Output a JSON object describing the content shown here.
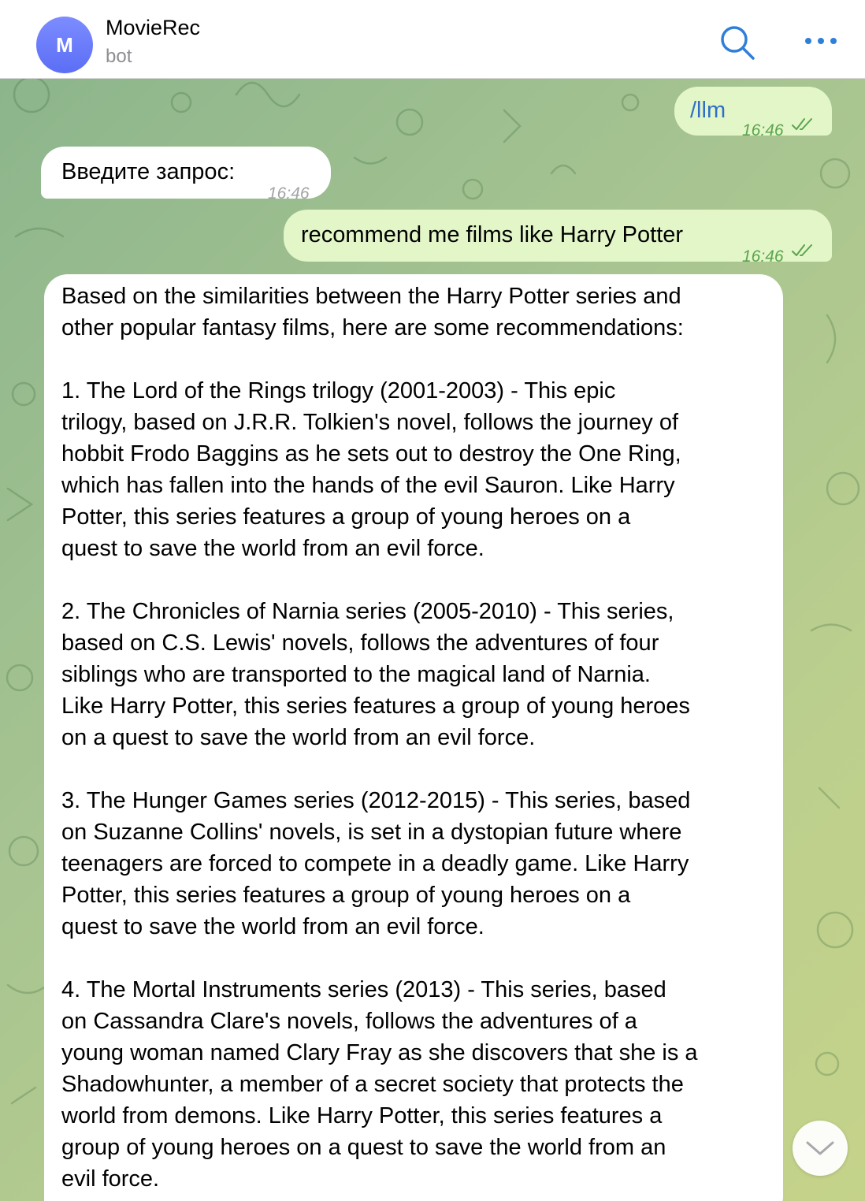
{
  "header": {
    "avatar_letter": "M",
    "title": "MovieRec",
    "subtitle": "bot",
    "search_icon": "search-icon",
    "more_icon": "more-dots-icon"
  },
  "colors": {
    "accent": "#2f6fc8",
    "avatar": "#6b7cf8",
    "outgoing_bubble": "#e3f6c8",
    "incoming_bubble": "#ffffff",
    "outgoing_time": "#5ba450"
  },
  "messages": [
    {
      "direction": "out",
      "text": "/llm",
      "time": "16:46",
      "status": "read"
    },
    {
      "direction": "in",
      "text": "Введите запрос:",
      "time": "16:46"
    },
    {
      "direction": "out",
      "text": "recommend me films like Harry Potter",
      "time": "16:46",
      "status": "read"
    },
    {
      "direction": "in",
      "text": "Based on the similarities between the Harry Potter series and\nother popular fantasy films, here are some recommendations:\n\n1. The Lord of the Rings trilogy (2001-2003) - This epic\ntrilogy, based on J.R.R. Tolkien's novel, follows the journey of\nhobbit Frodo Baggins as he sets out to destroy the One Ring,\nwhich has fallen into the hands of the evil Sauron. Like Harry\nPotter, this series features a group of young heroes on a\nquest to save the world from an evil force.\n\n2. The Chronicles of Narnia series (2005-2010) - This series,\nbased on C.S. Lewis' novels, follows the adventures of four\nsiblings who are transported to the magical land of Narnia.\nLike Harry Potter, this series features a group of young heroes\non a quest to save the world from an evil force.\n\n3. The Hunger Games series (2012-2015) - This series, based\non Suzanne Collins' novels, is set in a dystopian future where\nteenagers are forced to compete in a deadly game. Like Harry\nPotter, this series features a group of young heroes on a\nquest to save the world from an evil force.\n\n4. The Mortal Instruments series (2013) - This series, based\non Cassandra Clare's novels, follows the adventures of a\nyoung woman named Clary Fray as she discovers that she is a\nShadowhunter, a member of a secret society that protects the\nworld from demons. Like Harry Potter, this series features a\ngroup of young heroes on a quest to save the world from an\nevil force."
    }
  ],
  "scroll_down_icon": "chevron-down-icon"
}
